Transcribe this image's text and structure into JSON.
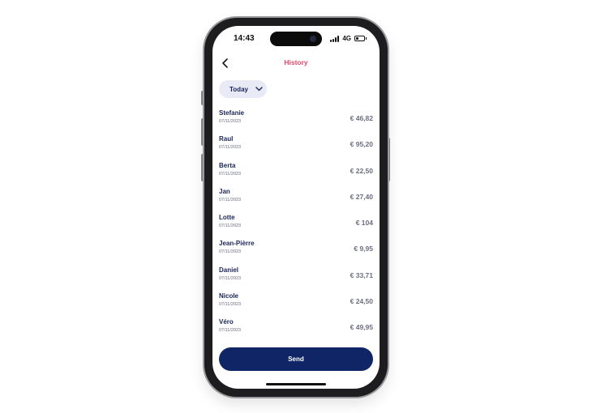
{
  "status_bar": {
    "time": "14:43",
    "network": "4G",
    "battery_level": 0.35
  },
  "header": {
    "title": "History",
    "back_icon": "chevron-left-icon"
  },
  "filter": {
    "label": "Today",
    "icon": "chevron-down-icon"
  },
  "transactions": [
    {
      "name": "Stefanie",
      "date": "07/11/2023",
      "amount": "€ 46,82"
    },
    {
      "name": "Raul",
      "date": "07/11/2023",
      "amount": "€ 95,20"
    },
    {
      "name": "Berta",
      "date": "07/11/2023",
      "amount": "€ 22,50"
    },
    {
      "name": "Jan",
      "date": "07/11/2023",
      "amount": "€ 27,40"
    },
    {
      "name": "Lotte",
      "date": "07/11/2023",
      "amount": "€ 104"
    },
    {
      "name": "Jean-Pièrre",
      "date": "07/11/2023",
      "amount": "€ 9,95"
    },
    {
      "name": "Daniel",
      "date": "07/11/2023",
      "amount": "€ 33,71"
    },
    {
      "name": "Nicole",
      "date": "07/11/2023",
      "amount": "€ 24,50"
    },
    {
      "name": "Véro",
      "date": "07/11/2023",
      "amount": "€ 49,95"
    }
  ],
  "footer": {
    "send_label": "Send"
  },
  "colors": {
    "accent": "#e0476a",
    "primary": "#0f2566",
    "text_dark": "#1a2558",
    "chip_bg": "#e8ebf6"
  }
}
